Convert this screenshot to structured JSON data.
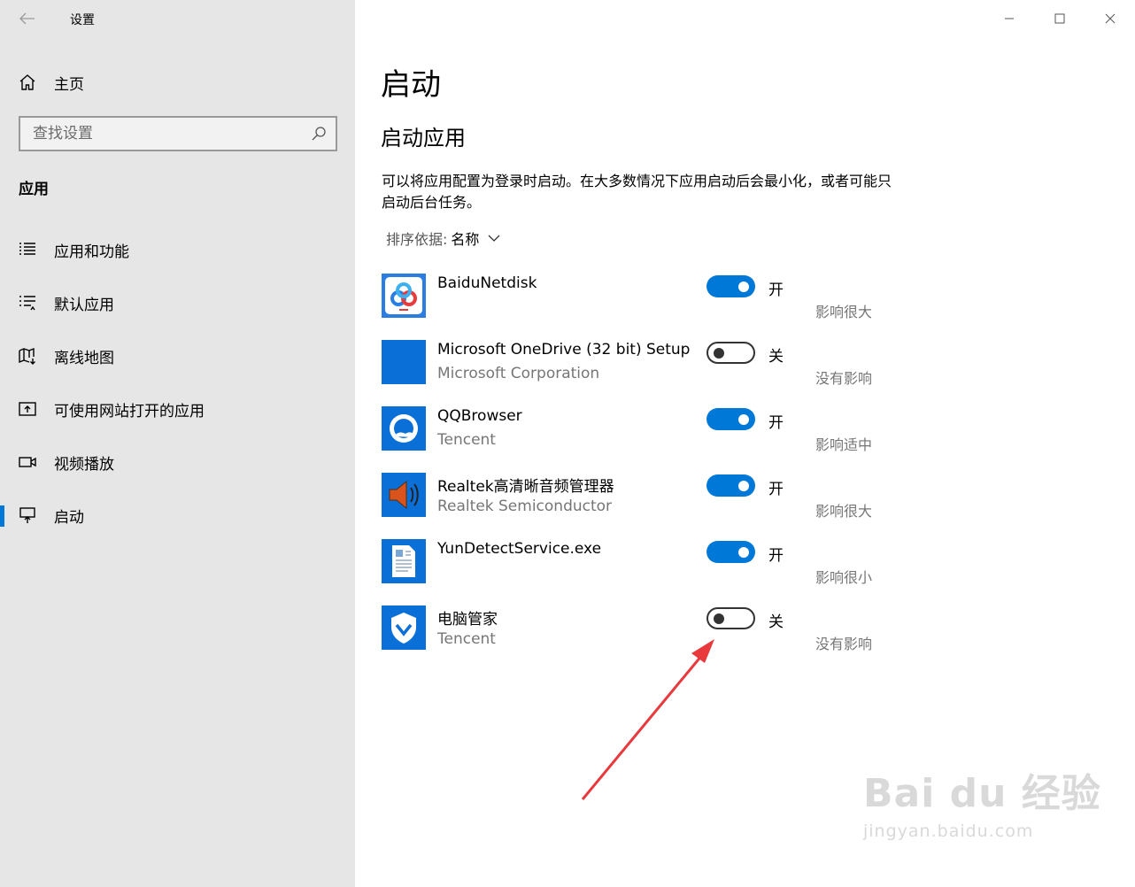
{
  "window": {
    "title": "设置"
  },
  "sidebar": {
    "home_label": "主页",
    "search_placeholder": "查找设置",
    "section_title": "应用",
    "items": [
      {
        "label": "应用和功能",
        "icon": "apps-features-icon"
      },
      {
        "label": "默认应用",
        "icon": "default-apps-icon"
      },
      {
        "label": "离线地图",
        "icon": "offline-maps-icon"
      },
      {
        "label": "可使用网站打开的应用",
        "icon": "apps-for-websites-icon"
      },
      {
        "label": "视频播放",
        "icon": "video-playback-icon"
      },
      {
        "label": "启动",
        "icon": "startup-icon",
        "active": true
      }
    ]
  },
  "main": {
    "title": "启动",
    "subtitle": "启动应用",
    "description": "可以将应用配置为登录时启动。在大多数情况下应用启动后会最小化，或者可能只启动后台任务。",
    "sort_label": "排序依据:",
    "sort_value": "名称",
    "apps": [
      {
        "name": "BaiduNetdisk",
        "publisher": "",
        "on": true,
        "state": "开",
        "impact": "影响很大"
      },
      {
        "name": "Microsoft OneDrive (32 bit) Setup",
        "publisher": "Microsoft Corporation",
        "on": false,
        "state": "关",
        "impact": "没有影响"
      },
      {
        "name": "QQBrowser",
        "publisher": "Tencent",
        "on": true,
        "state": "开",
        "impact": "影响适中"
      },
      {
        "name": "Realtek高清晰音频管理器",
        "publisher": "Realtek Semiconductor",
        "on": true,
        "state": "开",
        "impact": "影响很大"
      },
      {
        "name": "YunDetectService.exe",
        "publisher": "",
        "on": true,
        "state": "开",
        "impact": "影响很小"
      },
      {
        "name": "电脑管家",
        "publisher": "Tencent",
        "on": false,
        "state": "关",
        "impact": "没有影响"
      }
    ]
  },
  "watermark": {
    "brand": "Bai du 经验",
    "url": "jingyan.baidu.com"
  },
  "colors": {
    "accent": "#0078d7",
    "sidebar_bg": "#e6e6e6",
    "annotation_arrow": "#e8393d"
  }
}
